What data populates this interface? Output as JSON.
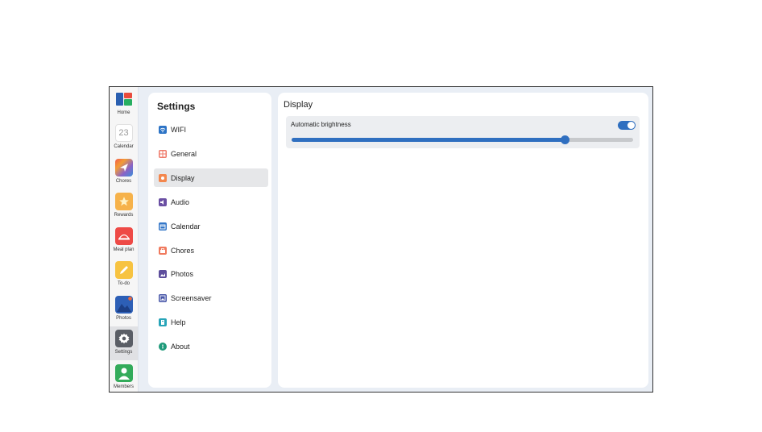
{
  "rail": {
    "items": [
      {
        "label": "Home",
        "icon": "home-grid-icon"
      },
      {
        "label": "Calendar",
        "icon": "calendar-date-icon",
        "day": "23"
      },
      {
        "label": "Chores",
        "icon": "chores-icon"
      },
      {
        "label": "Rewards",
        "icon": "star-icon"
      },
      {
        "label": "Meal plan",
        "icon": "meal-plan-icon"
      },
      {
        "label": "To-do",
        "icon": "pencil-icon"
      },
      {
        "label": "Photos",
        "icon": "photos-icon"
      },
      {
        "label": "Settings",
        "icon": "gear-icon"
      },
      {
        "label": "Members",
        "icon": "person-icon"
      }
    ],
    "active": "Settings"
  },
  "menu": {
    "title": "Settings",
    "items": [
      {
        "label": "WIFI",
        "icon": "wifi-icon",
        "color": "#2d74c6"
      },
      {
        "label": "General",
        "icon": "general-icon",
        "color": "#ef7a6a"
      },
      {
        "label": "Display",
        "icon": "display-icon",
        "color": "#f3874e"
      },
      {
        "label": "Audio",
        "icon": "speaker-icon",
        "color": "#6a4fa3"
      },
      {
        "label": "Calendar",
        "icon": "calendar-icon",
        "color": "#3477c8"
      },
      {
        "label": "Chores",
        "icon": "chores-icon",
        "color": "#f07a5e"
      },
      {
        "label": "Photos",
        "icon": "photos-icon",
        "color": "#5e4e9c"
      },
      {
        "label": "Screensaver",
        "icon": "screensaver-icon",
        "color": "#4857a8"
      },
      {
        "label": "Help",
        "icon": "help-icon",
        "color": "#27a4b8"
      },
      {
        "label": "About",
        "icon": "info-icon",
        "color": "#1e9a7a"
      }
    ],
    "active": "Display"
  },
  "content": {
    "title": "Display",
    "auto_brightness_label": "Automatic brightness",
    "auto_brightness_enabled": true,
    "brightness_level": 0.8
  },
  "colors": {
    "accent": "#2f6fc0",
    "track": "#c7c9cc"
  }
}
